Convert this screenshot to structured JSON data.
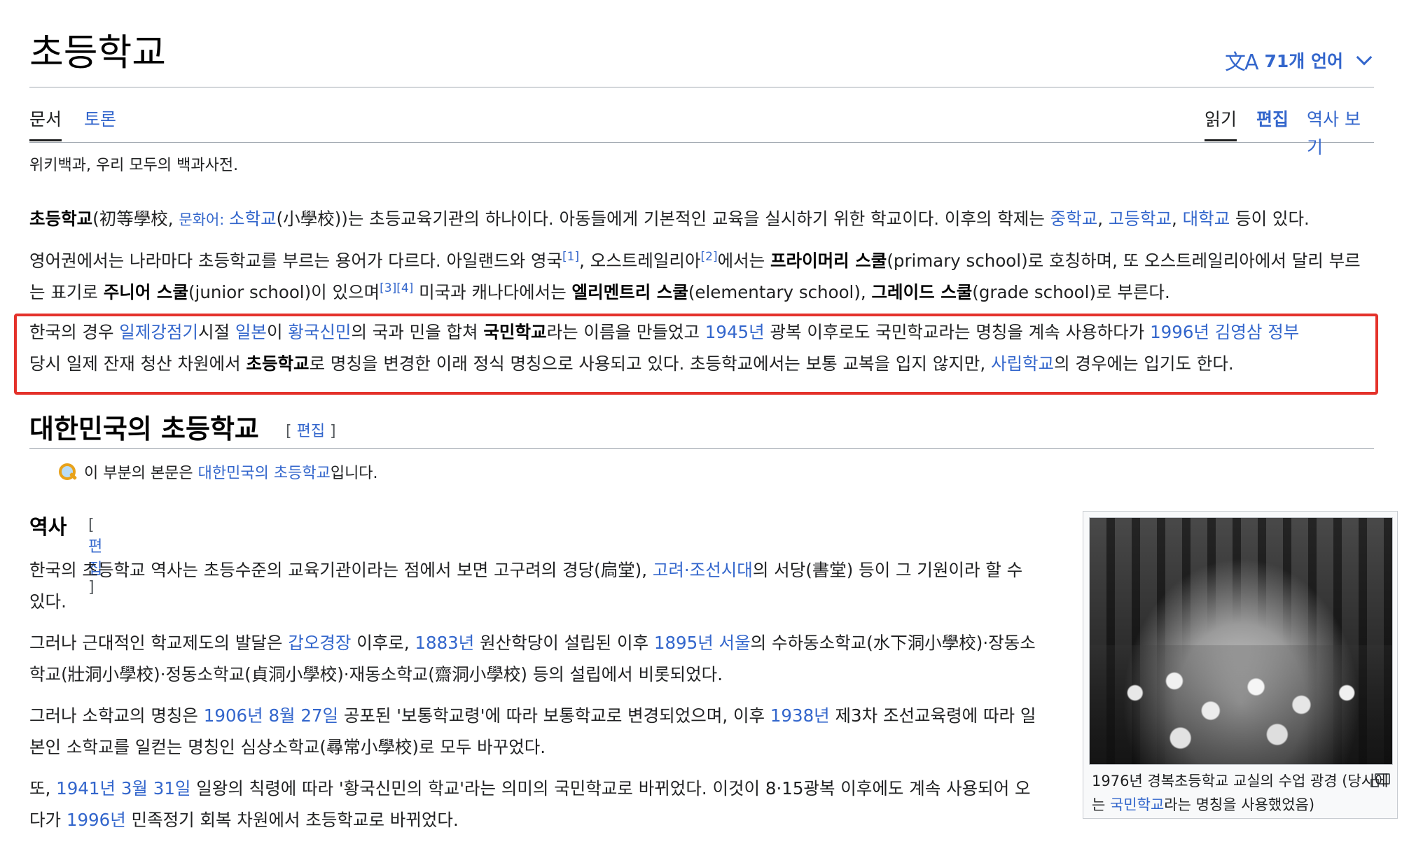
{
  "title": "초등학교",
  "languages": {
    "icon": "translate-icon",
    "label": "71개 언어"
  },
  "tabs_left": [
    {
      "label": "문서"
    },
    {
      "label": "토론"
    }
  ],
  "tabs_right": [
    {
      "label": "읽기"
    },
    {
      "label": "편집"
    },
    {
      "label": "역사 보기"
    }
  ],
  "tagline": "위키백과, 우리 모두의 백과사전.",
  "intro": {
    "p1": {
      "t1": "초등학교",
      "t2": "(初等學校, ",
      "t3": "문화어: ",
      "t4": "소학교",
      "t5": "(小學校))는 초등교육기관의 하나이다. 아동들에게 기본적인 교육을 실시하기 위한 학교이다. 이후의 학제는 ",
      "t6": "중학교",
      "t7": ", ",
      "t8": "고등학교",
      "t9": ", ",
      "t10": "대학교",
      "t11": " 등이 있다."
    },
    "p2": {
      "t1": "영어권에서는 나라마다 초등학교를 부르는 용어가 다르다. 아일랜드와 영국",
      "r1": "[1]",
      "t2": ", 오스트레일리아",
      "r2": "[2]",
      "t3": "에서는 ",
      "b1": "프라이머리 스쿨",
      "t4": "(primary school)로 호칭하며, 또 오스트레일리아에서 달리 부르는 표기로 ",
      "b2": "주니어 스쿨",
      "t5": "(junior school)이 있으며",
      "r3": "[3]",
      "r4": "[4]",
      "t6": " 미국과 캐나다에서는 ",
      "b3": "엘리멘트리 스쿨",
      "t7": "(elementary school), ",
      "b4": "그레이드 스쿨",
      "t8": "(grade school)로 부른다."
    },
    "p3": {
      "t1": "한국의 경우 ",
      "l1": "일제강점기",
      "t2": "시절 ",
      "l2": "일본",
      "t3": "이 ",
      "l3": "황국신민",
      "t4": "의 국과 민을 합쳐 ",
      "b1": "국민학교",
      "t5": "라는 이름을 만들었고 ",
      "l4": "1945년",
      "t6": " 광복 이후로도 국민학교라는 명칭을 계속 사용하다가 ",
      "l5": "1996년",
      "t7": " ",
      "l6": "김영삼 정부",
      "t8": "당시 일제 잔재 청산 차원에서 ",
      "b2": "초등학교",
      "t9": "로 명칭을 변경한 이래 정식 명칭으로 사용되고 있다. 초등학교에서는 보통 교복을 입지 않지만, ",
      "l7": "사립학교",
      "t10": "의 경우에는 입기도 한다."
    }
  },
  "section": {
    "heading": "대한민국의 초등학교",
    "edit_open": "[ ",
    "edit_label": "편집",
    "edit_close": " ]",
    "hatnote": {
      "t1": "이 부분의 본문은 ",
      "link": "대한민국의 초등학교",
      "t2": "입니다."
    }
  },
  "subsection": {
    "heading": "역사",
    "edit_label": "편집"
  },
  "history": {
    "p1": {
      "t1": "한국의 초등학교 역사는 초등수준의 교육기관이라는 점에서 보면 고구려의 경당(扃堂), ",
      "l1": "고려·조선시대",
      "t2": "의 서당(書堂) 등이 그 기원이라 할 수 있다."
    },
    "p2": {
      "t1": "그러나 근대적인 학교제도의 발달은 ",
      "l1": "갑오경장",
      "t2": " 이후로, ",
      "l2": "1883년",
      "t3": " 원산학당이 설립된 이후 ",
      "l3": "1895년",
      "t4": " ",
      "l4": "서울",
      "t5": "의 수하동소학교(水下洞小學校)·장동소학교(壯洞小學校)·정동소학교(貞洞小學校)·재동소학교(齋洞小學校) 등의 설립에서 비롯되었다."
    },
    "p3": {
      "t1": "그러나 소학교의 명칭은 ",
      "l1": "1906년",
      "t2": " ",
      "l2": "8월 27일",
      "t3": " 공포된 '보통학교령'에 따라 보통학교로 변경되었으며, 이후 ",
      "l3": "1938년",
      "t4": " 제3차 조선교육령에 따라 일본인 소학교를 일컫는 명칭인 심상소학교(尋常小學校)로 모두 바꾸었다."
    },
    "p4": {
      "t1": "또, ",
      "l1": "1941년",
      "t2": " ",
      "l2": "3월 31일",
      "t3": " 일왕의 칙령에 따라 '황국신민의 학교'라는 의미의 국민학교로 바뀌었다. 이것이 8·15광복 이후에도 계속 사용되어 오다가 ",
      "l3": "1996년",
      "t4": " 민족정기 회복 차원에서 초등학교로 바뀌었다."
    }
  },
  "figure": {
    "caption_t1": "1976년 경복초등학교 교실의 수업 광경 (당시에는 ",
    "caption_link": "국민학교",
    "caption_t2": "라는 명칭을 사용했었음)"
  },
  "colors": {
    "link": "#3366cc",
    "highlight_border": "#e4322b",
    "text": "#202122"
  }
}
